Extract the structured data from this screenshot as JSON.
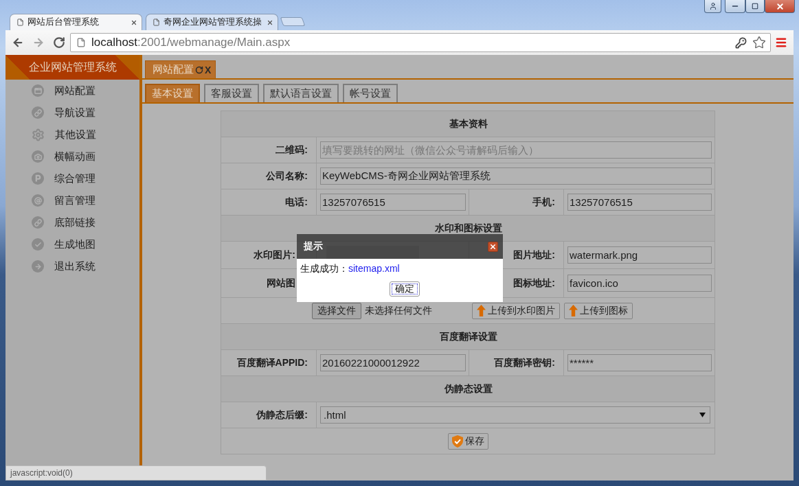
{
  "browser": {
    "tabs": [
      {
        "title": "网站后台管理系统",
        "selected": true
      },
      {
        "title": "奇网企业网站管理系统操",
        "selected": false
      }
    ],
    "address": {
      "host": "localhost",
      "path": ":2001/webmanage/Main.aspx"
    }
  },
  "sidebar": {
    "title": "企业网站管理系统",
    "items": [
      {
        "label": "网站配置"
      },
      {
        "label": "导航设置"
      },
      {
        "label": "其他设置"
      },
      {
        "label": "横幅动画"
      },
      {
        "label": "综合管理"
      },
      {
        "label": "留言管理"
      },
      {
        "label": "底部链接"
      },
      {
        "label": "生成地图"
      },
      {
        "label": "退出系统"
      }
    ]
  },
  "page_tabs": [
    {
      "label": "网站配置",
      "close": "X",
      "selected": true
    }
  ],
  "sub_tabs": [
    {
      "label": "基本设置",
      "selected": true
    },
    {
      "label": "客服设置",
      "selected": false
    },
    {
      "label": "默认语言设置",
      "selected": false
    },
    {
      "label": "帐号设置",
      "selected": false
    }
  ],
  "form": {
    "sections": [
      {
        "title": "基本资料",
        "rows": [
          {
            "kind": "wide",
            "label": "二维码:",
            "placeholder": "填写要跳转的网址（微信公众号请解码后输入）"
          },
          {
            "kind": "wide",
            "label": "公司名称:",
            "value": "KeyWebCMS-奇网企业网站管理系统"
          },
          {
            "kind": "pair",
            "fields": [
              {
                "kind": "input",
                "label": "电话:",
                "value": "13257076515"
              },
              {
                "kind": "input",
                "label": "手机:",
                "value": "13257076515"
              }
            ]
          }
        ]
      },
      {
        "title": "水印和图标设置",
        "rows": [
          {
            "kind": "pair",
            "fields": [
              {
                "kind": "image",
                "label": "水印图片:"
              },
              {
                "kind": "input",
                "label": "图片地址:",
                "value": "watermark.png"
              }
            ]
          },
          {
            "kind": "pair",
            "fields": [
              {
                "kind": "blank",
                "label": "网站图"
              },
              {
                "kind": "input",
                "label": "图标地址:",
                "value": "favicon.ico"
              }
            ]
          },
          {
            "kind": "upload",
            "file_button": "选择文件",
            "file_status": "未选择任何文件",
            "buttons": [
              "上传到水印图片",
              "上传到图标"
            ]
          }
        ]
      },
      {
        "title": "百度翻译设置",
        "rows": [
          {
            "kind": "pair",
            "fields": [
              {
                "kind": "input",
                "label": "百度翻译APPID:",
                "value": "20160221000012922"
              },
              {
                "kind": "input",
                "label": "百度翻译密钥:",
                "value": "******"
              }
            ]
          }
        ]
      },
      {
        "title": "伪静态设置",
        "rows": [
          {
            "kind": "select",
            "label": "伪静态后缀:",
            "value": ".html"
          }
        ]
      }
    ],
    "save_button": "保存"
  },
  "dialog": {
    "title": "提示",
    "message": "生成成功：",
    "link": "sitemap.xml",
    "button": "确定"
  },
  "status_bar": {
    "text": "javascript:void(0)"
  }
}
